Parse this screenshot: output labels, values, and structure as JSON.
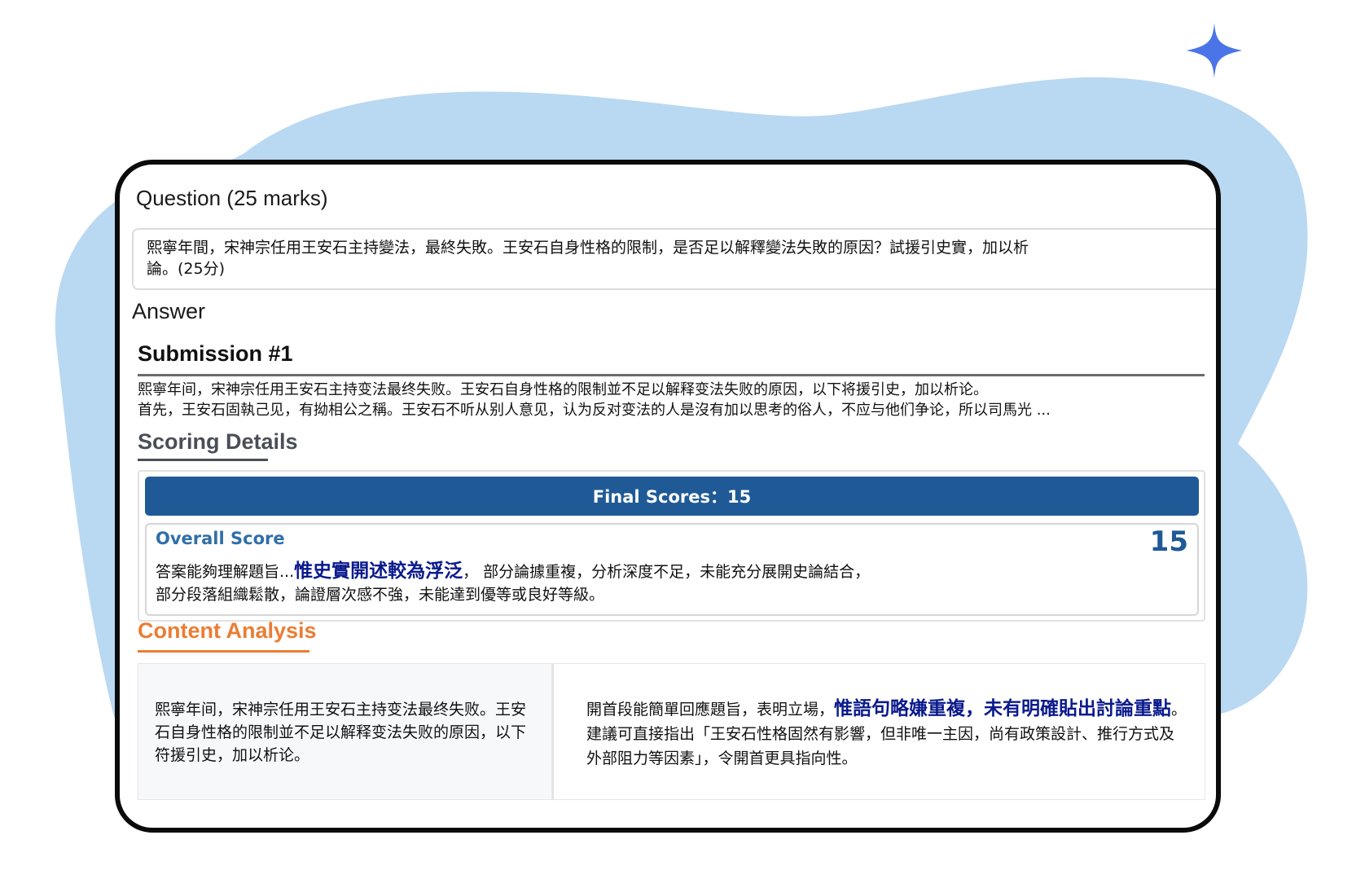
{
  "question": {
    "heading": "Question (25 marks)",
    "text_line1": "熙寧年間，宋神宗任用王安石主持變法，最終失敗。王安石自身性格的限制，是否足以解釋變法失敗的原因？試援引史實，加以析",
    "text_line2": "論。(25分)"
  },
  "answer": {
    "heading": "Answer"
  },
  "submission": {
    "title": "Submission #1",
    "line1": "熙寧年间，宋神宗任用王安石主持变法最终失败。王安石自身性格的限制並不足以解释变法失败的原因，以下将援引史，加以析论。",
    "line2": "首先，王安石固執己见，有拗相公之稱。王安石不听从别人意见，认为反对变法的人是沒有加以思考的俗人，不应与他们争论，所以司馬光 ..."
  },
  "scoring": {
    "title": "Scoring Details",
    "final_label": "Final Scores：15",
    "overall_label": "Overall Score",
    "overall_value": "15",
    "comment_pre": "答案能夠理解題旨...",
    "comment_highlight": "惟史實開述較為浮泛",
    "comment_post": "，  部分論據重複，分析深度不足，未能充分展開史論結合，",
    "comment_line2": "部分段落組織鬆散，論證層次感不強，未能達到優等或良好等級。"
  },
  "content_analysis": {
    "title": "Content Analysis",
    "left_text": "熙寧年间，宋神宗任用王安石主持变法最终失败。王安石自身性格的限制並不足以解释变法失败的原因，以下符援引史，加以析论。",
    "right_pre": "開首段能簡單回應題旨，表明立場，",
    "right_highlight1": "惟語句略嫌重複",
    "right_highlight2": "，未有明確貼出討論重點",
    "right_post": "。建議可直接指出「王安石性格固然有影響，但非唯一主因，尚有政策設計、推行方式及外部阻力等因素」，令開首更具指向性。"
  },
  "colors": {
    "blob": "#b9d8f2",
    "sparkle": "#4a74e8",
    "final_bar": "#1f5a96",
    "overall_label": "#2f6fa8",
    "highlight": "#0a1a8c",
    "content_accent": "#ea7d34"
  },
  "icons": {
    "sparkle": "sparkle-icon"
  }
}
